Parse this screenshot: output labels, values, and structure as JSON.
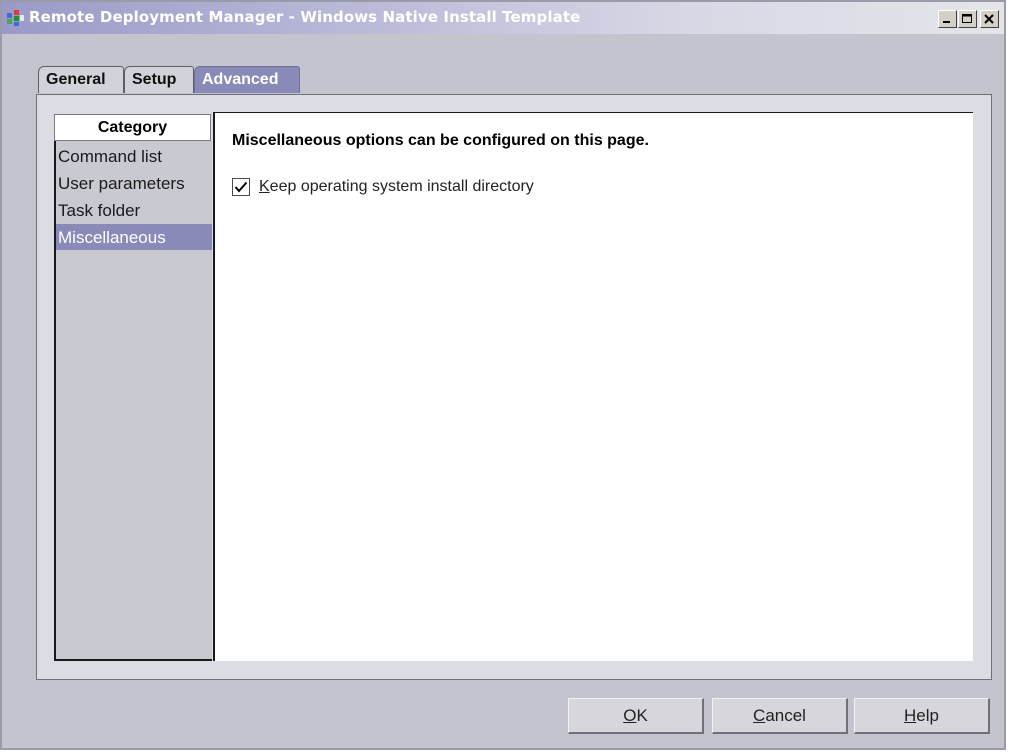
{
  "window": {
    "title": "Remote Deployment Manager - Windows Native Install Template",
    "icon": "rdm-app-icon",
    "controls": {
      "minimize_icon": "minimize-icon",
      "maximize_icon": "maximize-icon",
      "close_icon": "close-icon"
    }
  },
  "tabs": [
    {
      "label": "General",
      "active": false
    },
    {
      "label": "Setup",
      "active": false
    },
    {
      "label": "Advanced",
      "active": true
    }
  ],
  "category": {
    "header": "Category",
    "items": [
      {
        "label": "Command list",
        "selected": false
      },
      {
        "label": "User parameters",
        "selected": false
      },
      {
        "label": "Task folder",
        "selected": false
      },
      {
        "label": "Miscellaneous",
        "selected": true
      }
    ]
  },
  "page": {
    "heading": "Miscellaneous options can be configured on this page.",
    "checkbox": {
      "mnemonic": "K",
      "label_rest": "eep operating system install directory",
      "checked": true
    }
  },
  "buttons": {
    "ok": {
      "mnemonic": "O",
      "rest": "K"
    },
    "cancel": {
      "mnemonic": "C",
      "rest": "ancel"
    },
    "help": {
      "mnemonic": "H",
      "rest": "elp"
    }
  },
  "colors": {
    "selection": "#8a8ab8",
    "window_bg": "#c4c4cf",
    "panel_bg": "#dcdce4"
  }
}
